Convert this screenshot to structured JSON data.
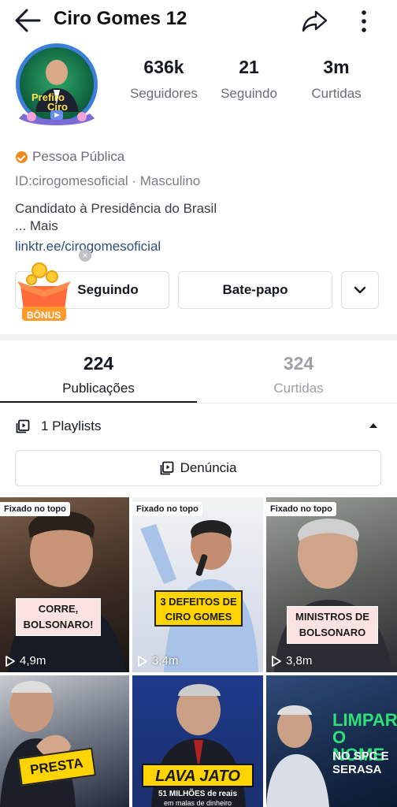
{
  "header": {
    "title": "Ciro Gomes 12"
  },
  "avatar": {
    "badge_text_1": "Prefiro",
    "badge_text_2": "Ciro"
  },
  "stats": [
    {
      "value": "636k",
      "label": "Seguidores"
    },
    {
      "value": "21",
      "label": "Seguindo"
    },
    {
      "value": "3m",
      "label": "Curtidas"
    }
  ],
  "profile": {
    "category": "Pessoa Pública",
    "id_line": "ID:cirogomesoficial · Masculino",
    "bio": "Candidato à Presidência do Brasil",
    "more": "...  Mais",
    "link": "linktr.ee/cirogomesoficial"
  },
  "buttons": {
    "following": "Seguindo",
    "chat": "Bate-papo"
  },
  "bonus": {
    "label": "BÔNUS"
  },
  "tabs": [
    {
      "count": "224",
      "label": "Publicações"
    },
    {
      "count": "324",
      "label": "Curtidas"
    }
  ],
  "playlist": {
    "label": "1 Playlists"
  },
  "report": {
    "label": "Denúncia"
  },
  "videos": [
    {
      "pinned": "Fixado no topo",
      "caption": "CORRE,\nBOLSONARO!",
      "views": "4,9m"
    },
    {
      "pinned": "Fixado no topo",
      "caption": "3 DEFEITOS DE\nCIRO GOMES",
      "views": "3,4m"
    },
    {
      "pinned": "Fixado no topo",
      "caption": "MINISTROS DE\nBOLSONARO",
      "views": "3,8m"
    },
    {
      "caption": "PRESTA"
    },
    {
      "caption": "LAVA JATO",
      "sub": "51 MILHÕES de reais",
      "sub2": "em malas de dinheiro"
    },
    {
      "caption": "LIMPAR\nO NOME",
      "sub": "NO SPC E\nSERASA"
    }
  ],
  "colors": {
    "accent_orange": "#f08a1c",
    "link": "#2f4e7e",
    "muted": "#6b6d75"
  }
}
